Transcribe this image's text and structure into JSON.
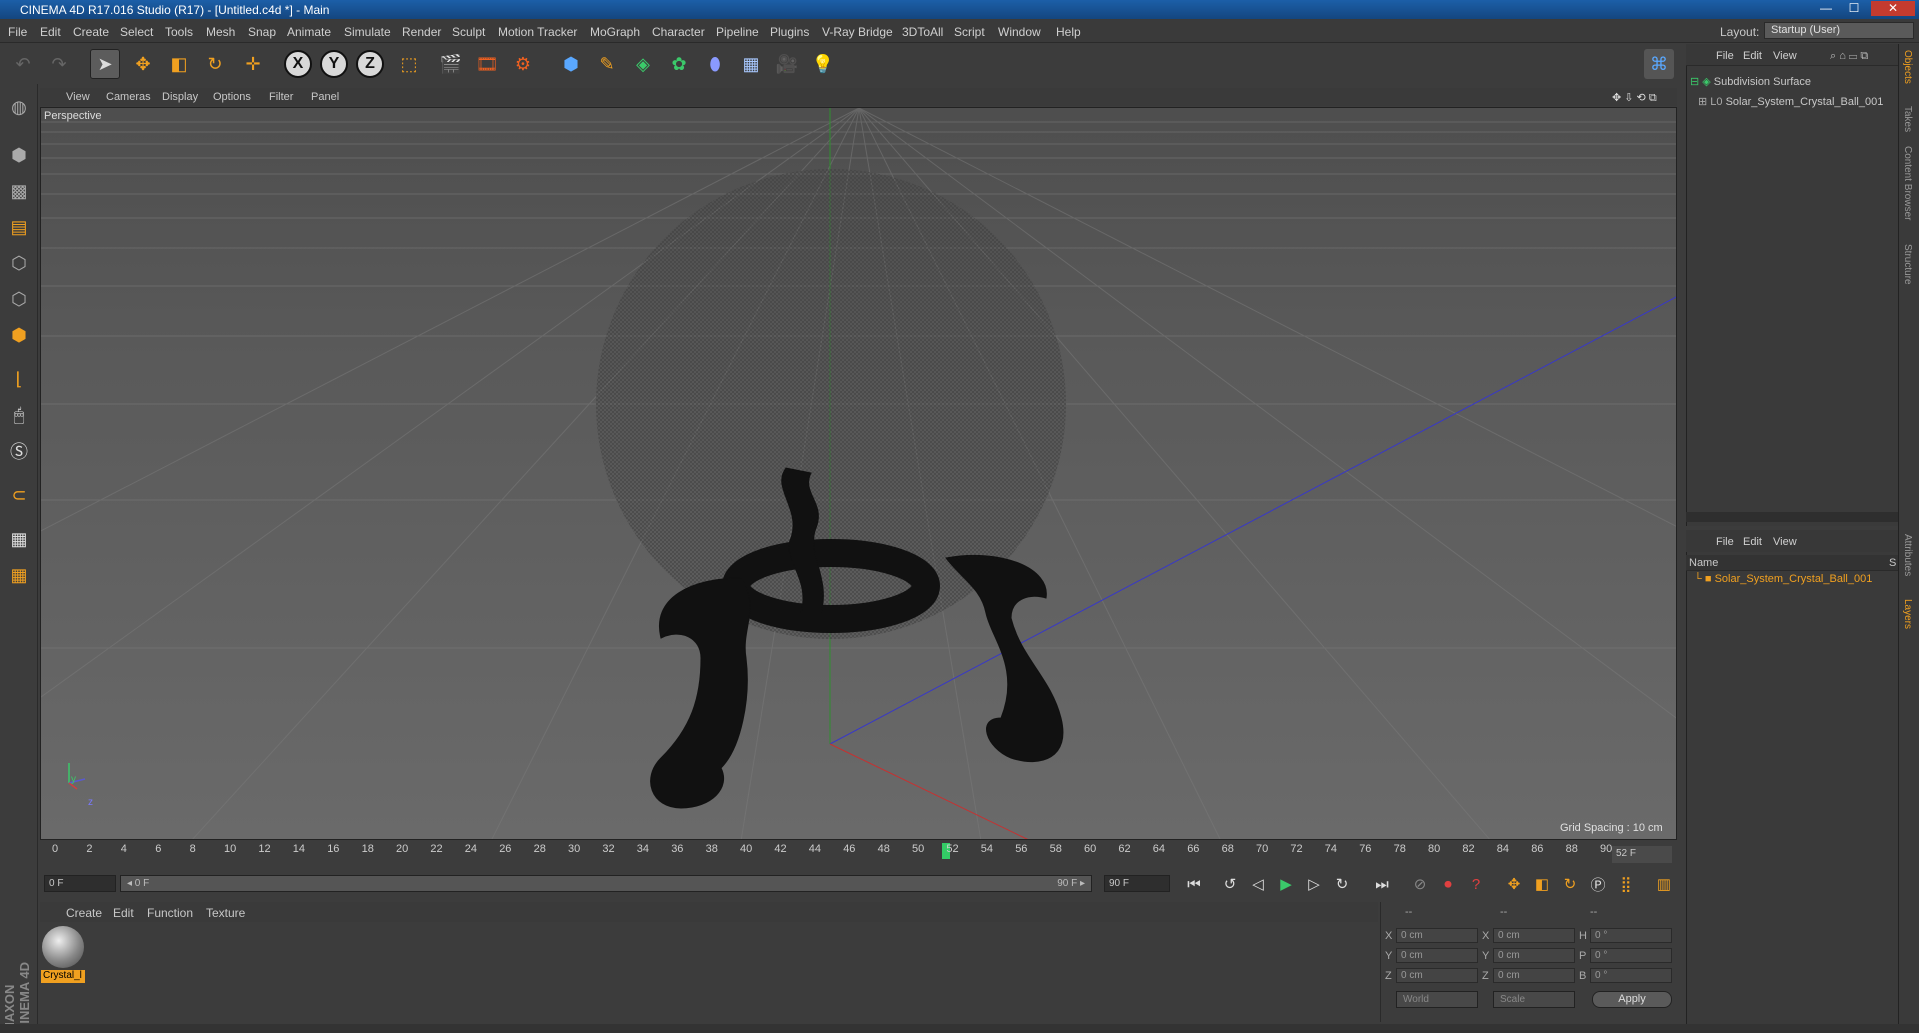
{
  "window": {
    "title": "CINEMA 4D R17.016 Studio (R17) - [Untitled.c4d *] - Main",
    "minimize": "—",
    "maximize": "☐",
    "close": "✕"
  },
  "menu": {
    "items": [
      "File",
      "Edit",
      "Create",
      "Select",
      "Tools",
      "Mesh",
      "Snap",
      "Animate",
      "Simulate",
      "Render",
      "Sculpt",
      "Motion Tracker",
      "MoGraph",
      "Character",
      "Pipeline",
      "Plugins",
      "V-Ray Bridge",
      "3DToAll",
      "Script",
      "Window",
      "Help"
    ],
    "layout_label": "Layout:",
    "layout_value": "Startup (User)"
  },
  "toolbar": {
    "axis_x": "X",
    "axis_y": "Y",
    "axis_z": "Z"
  },
  "viewport": {
    "menu": [
      "View",
      "Cameras",
      "Display",
      "Options",
      "Filter",
      "Panel"
    ],
    "label": "Perspective",
    "grid_spacing": "Grid Spacing : 10 cm",
    "axis_y": "y",
    "axis_z": "z"
  },
  "timeline": {
    "ticks": [
      "0",
      "2",
      "4",
      "6",
      "8",
      "10",
      "12",
      "14",
      "16",
      "18",
      "20",
      "22",
      "24",
      "26",
      "28",
      "30",
      "32",
      "34",
      "36",
      "38",
      "40",
      "42",
      "44",
      "46",
      "48",
      "50",
      "52",
      "54",
      "56",
      "58",
      "60",
      "62",
      "64",
      "66",
      "68",
      "70",
      "72",
      "74",
      "76",
      "78",
      "80",
      "82",
      "84",
      "86",
      "88",
      "90"
    ],
    "current_frame": 52,
    "end_field": "52 F"
  },
  "transport": {
    "start_field": "0 F",
    "range_start": "◂ 0 F",
    "range_end": "90 F ▸",
    "end_field": "90 F"
  },
  "material_manager": {
    "menu": [
      "Create",
      "Edit",
      "Function",
      "Texture"
    ],
    "material_name": "Crystal_l"
  },
  "coordinates": {
    "header": [
      "--",
      "--",
      "--"
    ],
    "rows": [
      {
        "a": "X",
        "av": "0 cm",
        "b": "X",
        "bv": "0 cm",
        "c": "H",
        "cv": "0 °"
      },
      {
        "a": "Y",
        "av": "0 cm",
        "b": "Y",
        "bv": "0 cm",
        "c": "P",
        "cv": "0 °"
      },
      {
        "a": "Z",
        "av": "0 cm",
        "b": "Z",
        "bv": "0 cm",
        "c": "B",
        "cv": "0 °"
      }
    ],
    "mode": "World",
    "size_mode": "Scale",
    "apply": "Apply"
  },
  "object_manager": {
    "menu": [
      "File",
      "Edit",
      "View"
    ],
    "items": [
      "Subdivision Surface",
      "Solar_System_Crystal_Ball_001"
    ]
  },
  "layer_manager": {
    "menu": [
      "File",
      "Edit",
      "View"
    ],
    "col_name": "Name",
    "col_s": "S",
    "items": [
      "Solar_System_Crystal_Ball_001"
    ]
  },
  "right_tabs": [
    "Objects",
    "Takes",
    "Content Browser",
    "Structure",
    "Attributes",
    "Layers"
  ],
  "branding": "MAXON CINEMA 4D",
  "colors": {
    "accent_orange": "#f0a020",
    "timeline_marker": "#33cc66",
    "title_blue": "#1c5fa8"
  }
}
